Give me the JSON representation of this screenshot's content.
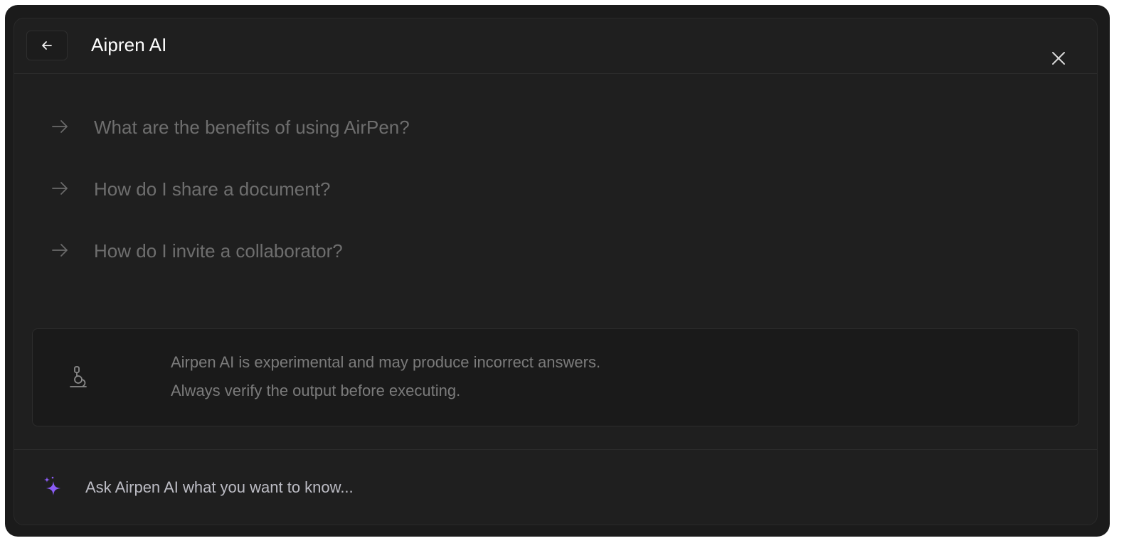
{
  "header": {
    "title": "Aipren AI",
    "back_icon": "arrow-left-icon",
    "close_icon": "close-icon"
  },
  "suggestions": [
    {
      "label": "What are the benefits of using AirPen?",
      "icon": "arrow-right-icon"
    },
    {
      "label": "How do I share a document?",
      "icon": "arrow-right-icon"
    },
    {
      "label": "How do I invite a collaborator?",
      "icon": "arrow-right-icon"
    }
  ],
  "notice": {
    "icon": "microscope-icon",
    "line1": "Airpen AI is experimental and may produce incorrect answers.",
    "line2": "Always verify the output before executing."
  },
  "ask": {
    "icon": "sparkle-icon",
    "placeholder": "Ask Airpen AI what you want to know..."
  },
  "colors": {
    "background": "#1f1f1f",
    "title": "#ffffff",
    "suggestion_text": "#6e6e6e",
    "accent_sparkle": "#8b5cf6"
  }
}
